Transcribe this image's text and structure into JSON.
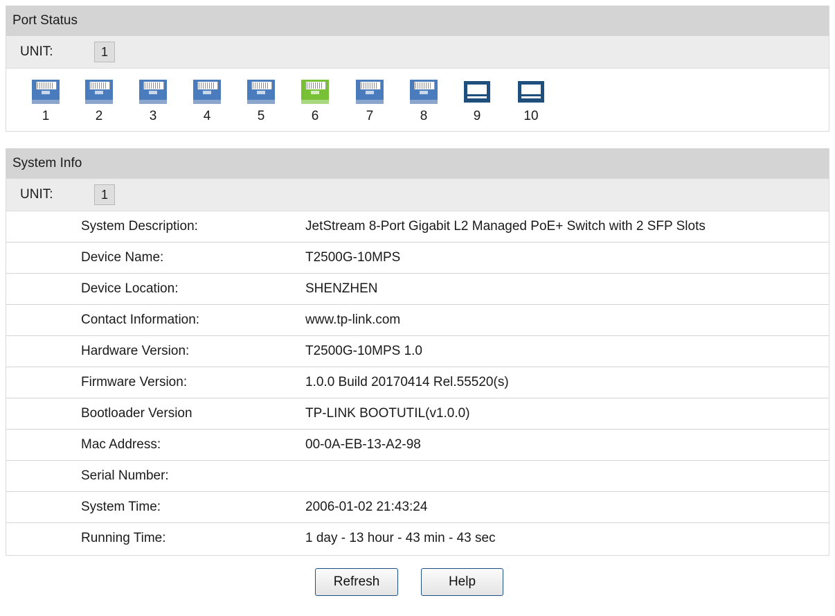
{
  "port_status": {
    "title": "Port Status",
    "unit_label": "UNIT:",
    "unit_value": "1",
    "ports": [
      {
        "number": "1",
        "type": "rj45",
        "status": "down",
        "icon": "rj45-port-icon"
      },
      {
        "number": "2",
        "type": "rj45",
        "status": "down",
        "icon": "rj45-port-icon"
      },
      {
        "number": "3",
        "type": "rj45",
        "status": "down",
        "icon": "rj45-port-icon"
      },
      {
        "number": "4",
        "type": "rj45",
        "status": "down",
        "icon": "rj45-port-icon"
      },
      {
        "number": "5",
        "type": "rj45",
        "status": "down",
        "icon": "rj45-port-icon"
      },
      {
        "number": "6",
        "type": "rj45",
        "status": "up",
        "icon": "rj45-port-icon"
      },
      {
        "number": "7",
        "type": "rj45",
        "status": "down",
        "icon": "rj45-port-icon"
      },
      {
        "number": "8",
        "type": "rj45",
        "status": "down",
        "icon": "rj45-port-icon"
      },
      {
        "number": "9",
        "type": "sfp",
        "status": "down",
        "icon": "sfp-port-icon"
      },
      {
        "number": "10",
        "type": "sfp",
        "status": "down",
        "icon": "sfp-port-icon"
      }
    ],
    "colors": {
      "port_down": "#4a7bbd",
      "port_up": "#78c036",
      "sfp": "#1f4f7d"
    }
  },
  "system_info": {
    "title": "System Info",
    "unit_label": "UNIT:",
    "unit_value": "1",
    "rows": [
      {
        "label": "System Description:",
        "value": "JetStream 8-Port Gigabit L2 Managed PoE+ Switch with 2 SFP Slots"
      },
      {
        "label": "Device Name:",
        "value": "T2500G-10MPS"
      },
      {
        "label": "Device Location:",
        "value": "SHENZHEN"
      },
      {
        "label": "Contact Information:",
        "value": "www.tp-link.com"
      },
      {
        "label": "Hardware Version:",
        "value": "T2500G-10MPS 1.0"
      },
      {
        "label": "Firmware Version:",
        "value": "1.0.0 Build 20170414 Rel.55520(s)"
      },
      {
        "label": "Bootloader Version",
        "value": "TP-LINK  BOOTUTIL(v1.0.0)"
      },
      {
        "label": "Mac Address:",
        "value": "00-0A-EB-13-A2-98"
      },
      {
        "label": "Serial Number:",
        "value": ""
      },
      {
        "label": "System Time:",
        "value": "2006-01-02 21:43:24"
      },
      {
        "label": "Running Time:",
        "value": "1 day - 13 hour - 43 min - 43 sec"
      }
    ]
  },
  "buttons": {
    "refresh_label": "Refresh",
    "help_label": "Help"
  }
}
